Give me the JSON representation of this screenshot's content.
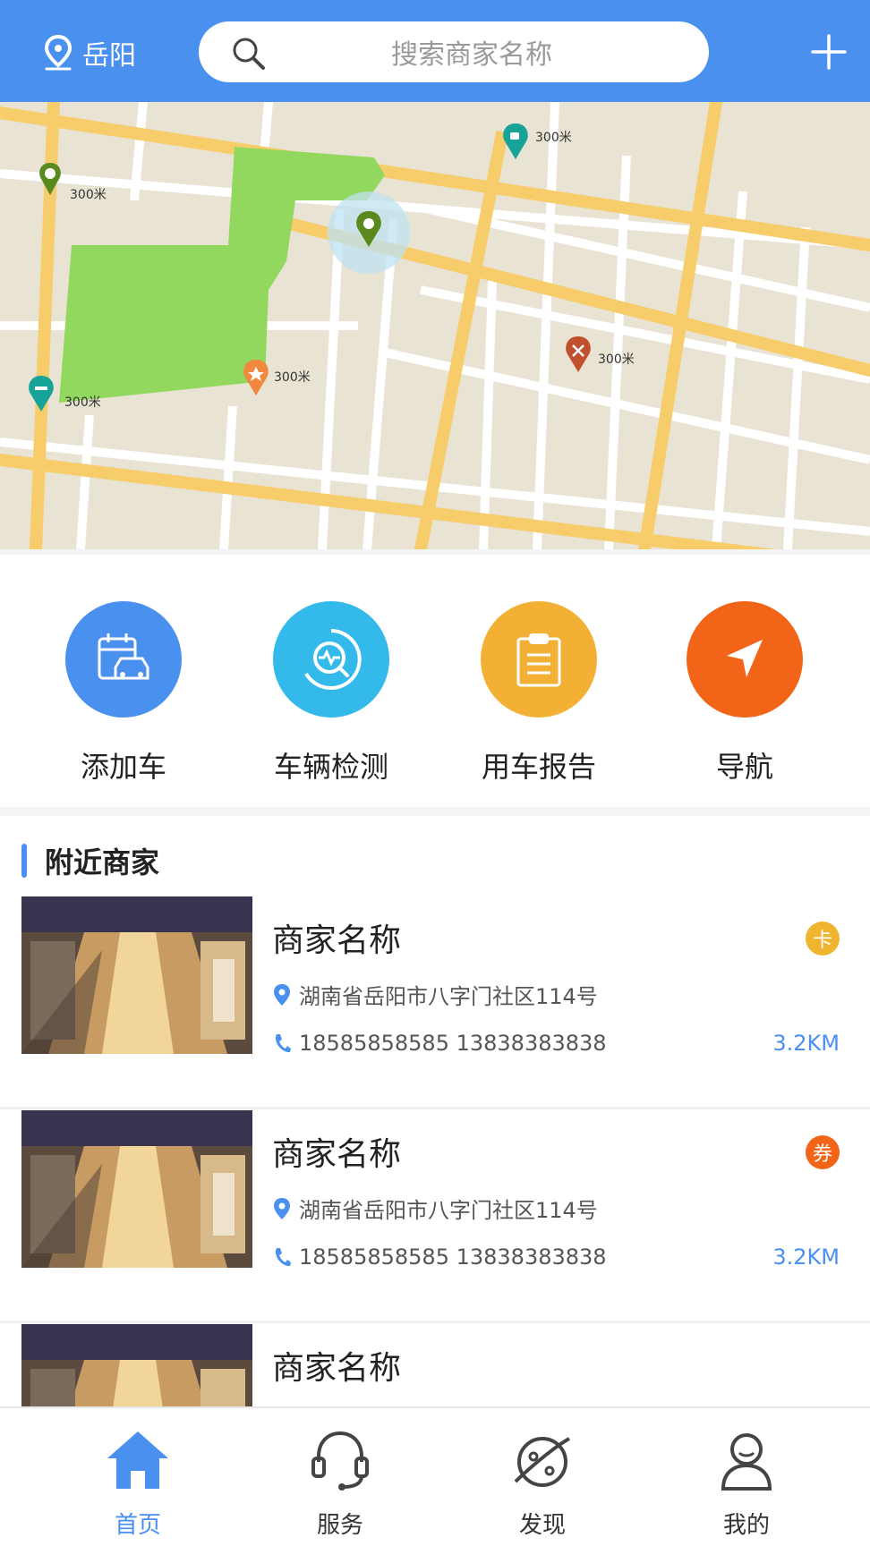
{
  "header": {
    "city": "岳阳",
    "search_placeholder": "搜索商家名称",
    "accent": "#4a90ee"
  },
  "map": {
    "markers": [
      {
        "label": "300米",
        "icon": "person-pin-icon",
        "color": "#5a8a1e"
      },
      {
        "label": "300米",
        "icon": "coffee-pin-icon",
        "color": "#17a398"
      },
      {
        "label": "300米",
        "icon": "star-pin-icon",
        "color": "#f0883f"
      },
      {
        "label": "300米",
        "icon": "bed-pin-icon",
        "color": "#17a398"
      },
      {
        "label": "300米",
        "icon": "restaurant-pin-icon",
        "color": "#c0502e"
      }
    ]
  },
  "actions": [
    {
      "label": "添加车",
      "icon": "add-car-icon",
      "color": "#4a90ee"
    },
    {
      "label": "车辆检测",
      "icon": "vehicle-inspection-icon",
      "color": "#33b9ea"
    },
    {
      "label": "用车报告",
      "icon": "report-clipboard-icon",
      "color": "#f2b134"
    },
    {
      "label": "导航",
      "icon": "navigation-arrow-icon",
      "color": "#f26418"
    }
  ],
  "nearby": {
    "title": "附近商家",
    "merchants": [
      {
        "name": "商家名称",
        "badge": "卡",
        "badge_color": "#f0b52f",
        "address": "湖南省岳阳市八字门社区114号",
        "phone": "18585858585  13838383838",
        "distance": "3.2KM"
      },
      {
        "name": "商家名称",
        "badge": "券",
        "badge_color": "#f26418",
        "address": "湖南省岳阳市八字门社区114号",
        "phone": "18585858585  13838383838",
        "distance": "3.2KM"
      },
      {
        "name": "商家名称"
      }
    ]
  },
  "tabbar": {
    "tabs": [
      {
        "label": "首页",
        "icon": "home-icon",
        "active": true
      },
      {
        "label": "服务",
        "icon": "headset-icon",
        "active": false
      },
      {
        "label": "发现",
        "icon": "discover-planet-icon",
        "active": false
      },
      {
        "label": "我的",
        "icon": "profile-icon",
        "active": false
      }
    ]
  }
}
